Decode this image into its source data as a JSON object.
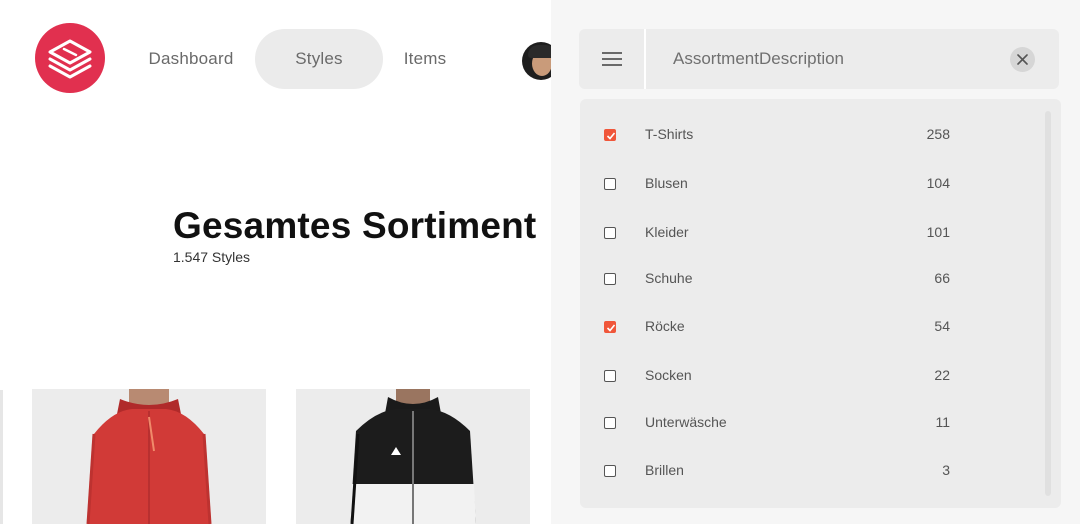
{
  "nav": {
    "items": [
      {
        "label": "Dashboard",
        "active": false
      },
      {
        "label": "Styles",
        "active": true
      },
      {
        "label": "Items",
        "active": false
      }
    ]
  },
  "icons": {
    "logo": "stack-layers-logo-icon",
    "avatar": "user-avatar",
    "menu": "hamburger-menu-icon",
    "clear": "close-icon",
    "check": "check-icon"
  },
  "colors": {
    "brand": "#e1304f",
    "checkbox_checked": "#f0563a",
    "nav_active_bg": "#ebebeb",
    "drawer_bg": "#f6f6f6",
    "panel_bg": "#ececec"
  },
  "page": {
    "title": "Gesamtes Sortiment",
    "subtitle": "1.547 Styles"
  },
  "filter": {
    "field_value": "AssortmentDescription",
    "options": [
      {
        "label": "T-Shirts",
        "count": "258",
        "checked": true
      },
      {
        "label": "Blusen",
        "count": "104",
        "checked": false
      },
      {
        "label": "Kleider",
        "count": "101",
        "checked": false
      },
      {
        "label": "Schuhe",
        "count": "66",
        "checked": false
      },
      {
        "label": "Röcke",
        "count": "54",
        "checked": true
      },
      {
        "label": "Socken",
        "count": "22",
        "checked": false
      },
      {
        "label": "Unterwäsche",
        "count": "11",
        "checked": false
      },
      {
        "label": "Brillen",
        "count": "3",
        "checked": false
      }
    ]
  }
}
